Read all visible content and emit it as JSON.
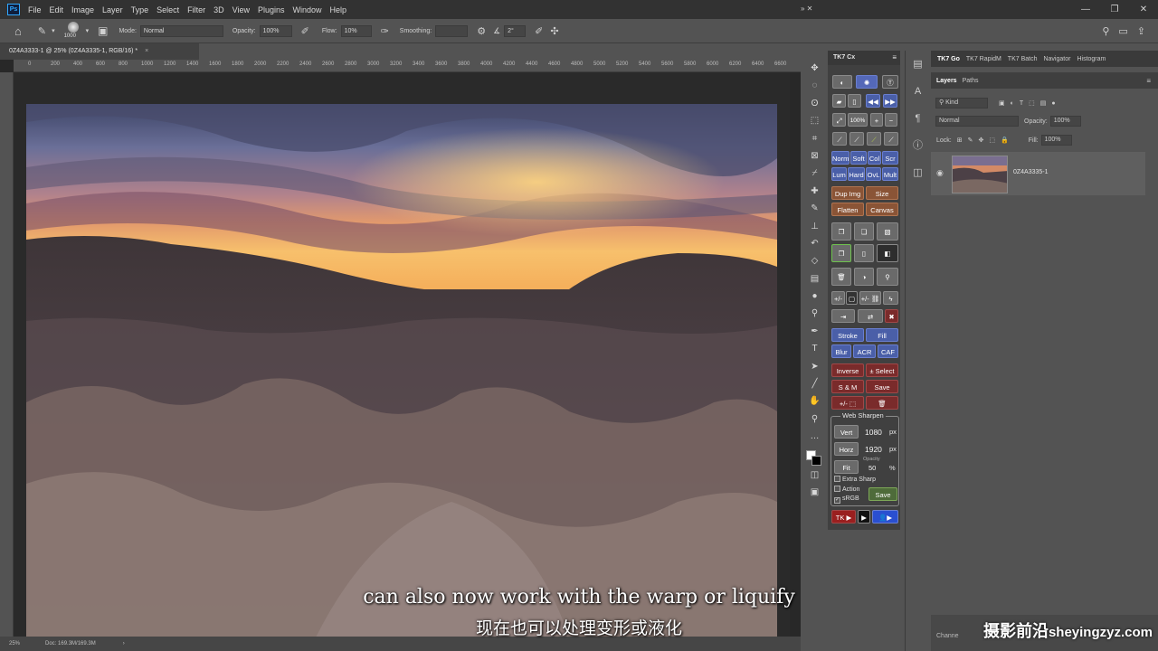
{
  "menubar": {
    "logo": "Ps",
    "items": [
      "File",
      "Edit",
      "Image",
      "Layer",
      "Type",
      "Select",
      "Filter",
      "3D",
      "View",
      "Plugins",
      "Window",
      "Help"
    ],
    "window_controls": [
      "—",
      "❐",
      "✕"
    ]
  },
  "options": {
    "brush_size": "1000",
    "mode_label": "Mode:",
    "mode_value": "Normal",
    "opacity_label": "Opacity:",
    "opacity_value": "100%",
    "flow_label": "Flow:",
    "flow_value": "10%",
    "smoothing_label": "Smoothing:",
    "smoothing_value": "",
    "angle_value": "2°"
  },
  "document": {
    "tab_title": "0Z4A3333-1 @ 25% (0Z4A3335-1, RGB/16) *",
    "zoom": "25%",
    "doc_info": "Doc: 169.3M/169.3M",
    "ruler_labels": [
      "0",
      "200",
      "400",
      "600",
      "800",
      "1000",
      "1200",
      "1400",
      "1600",
      "1800",
      "2000",
      "2200",
      "2400",
      "2600",
      "2800",
      "3000",
      "3200",
      "3400",
      "3600",
      "3800",
      "4000",
      "4200",
      "4400",
      "4600",
      "4800",
      "5000",
      "5200",
      "5400",
      "5600",
      "5800",
      "6000",
      "6200",
      "6400",
      "6600"
    ]
  },
  "tk7": {
    "panel_title": "TK7 Cx",
    "blend_row1": [
      "Norm",
      "Soft",
      "Col",
      "Scr"
    ],
    "blend_row2": [
      "Lum",
      "Hard",
      "OvL",
      "Mult"
    ],
    "dup_img": "Dup Img",
    "size": "Size",
    "flatten": "Flatten",
    "canvas": "Canvas",
    "stroke": "Stroke",
    "fill": "Fill",
    "blur": "Blur",
    "acr": "ACR",
    "caf": "CAF",
    "inverse": "Inverse",
    "plus_minus_select": "± Select",
    "s_and_m": "S & M",
    "save": "Save",
    "zoom_100": "100%",
    "web_sharpen": {
      "title": "Web Sharpen",
      "vert_label": "Vert",
      "vert_value": "1080",
      "horz_label": "Horz",
      "horz_value": "1920",
      "unit": "px",
      "fit_label": "Fit",
      "opacity_label": "Opacity",
      "opacity_value": "50",
      "percent": "%",
      "extra_sharp": "Extra Sharp",
      "action": "Action",
      "srgb": "sRGB",
      "save": "Save"
    },
    "footer_tk": "TK"
  },
  "right_panel": {
    "top_tabs": [
      "TK7 Go",
      "TK7 RapidM",
      "TK7 Batch",
      "Navigator",
      "Histogram"
    ],
    "layer_tabs": [
      "Layers",
      "Paths"
    ],
    "kind_value": "Kind",
    "blend_value": "Normal",
    "opacity_label": "Opacity:",
    "opacity_value": "100%",
    "lock_label": "Lock:",
    "fill_label": "Fill:",
    "fill_value": "100%",
    "layer_name": "0Z4A3335-1",
    "channels_label": "Channe"
  },
  "captions": {
    "english": "can also now work with the warp or liquify",
    "chinese": "现在也可以处理变形或液化"
  },
  "watermark": {
    "chinese": "摄影前沿",
    "url": "sheyingzyz.com"
  }
}
